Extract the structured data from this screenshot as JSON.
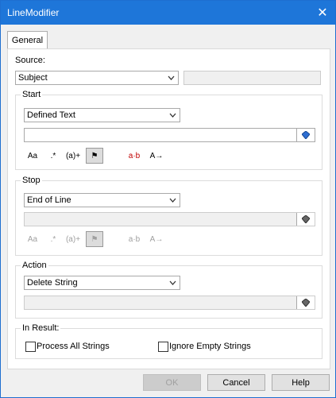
{
  "window": {
    "title": "LineModifier"
  },
  "tabs": [
    "General"
  ],
  "source": {
    "label": "Source:",
    "selected": "Subject",
    "text": ""
  },
  "start": {
    "title": "Start",
    "selected": "Defined Text",
    "text": "",
    "toolbar": [
      "Aa",
      ".*",
      "(a)+",
      "⚑",
      "a·b",
      "A→"
    ]
  },
  "stop": {
    "title": "Stop",
    "selected": "End of Line",
    "text": "",
    "toolbar": [
      "Aa",
      ".*",
      "(a)+",
      "⚑",
      "a·b",
      "A→"
    ]
  },
  "action": {
    "title": "Action",
    "selected": "Delete String",
    "text": ""
  },
  "result": {
    "title": "In Result:",
    "process_all": "Process All Strings",
    "ignore_empty": "Ignore Empty Strings"
  },
  "buttons": {
    "ok": "OK",
    "cancel": "Cancel",
    "help": "Help"
  },
  "colors": {
    "titlebar": "#1e76d9"
  }
}
